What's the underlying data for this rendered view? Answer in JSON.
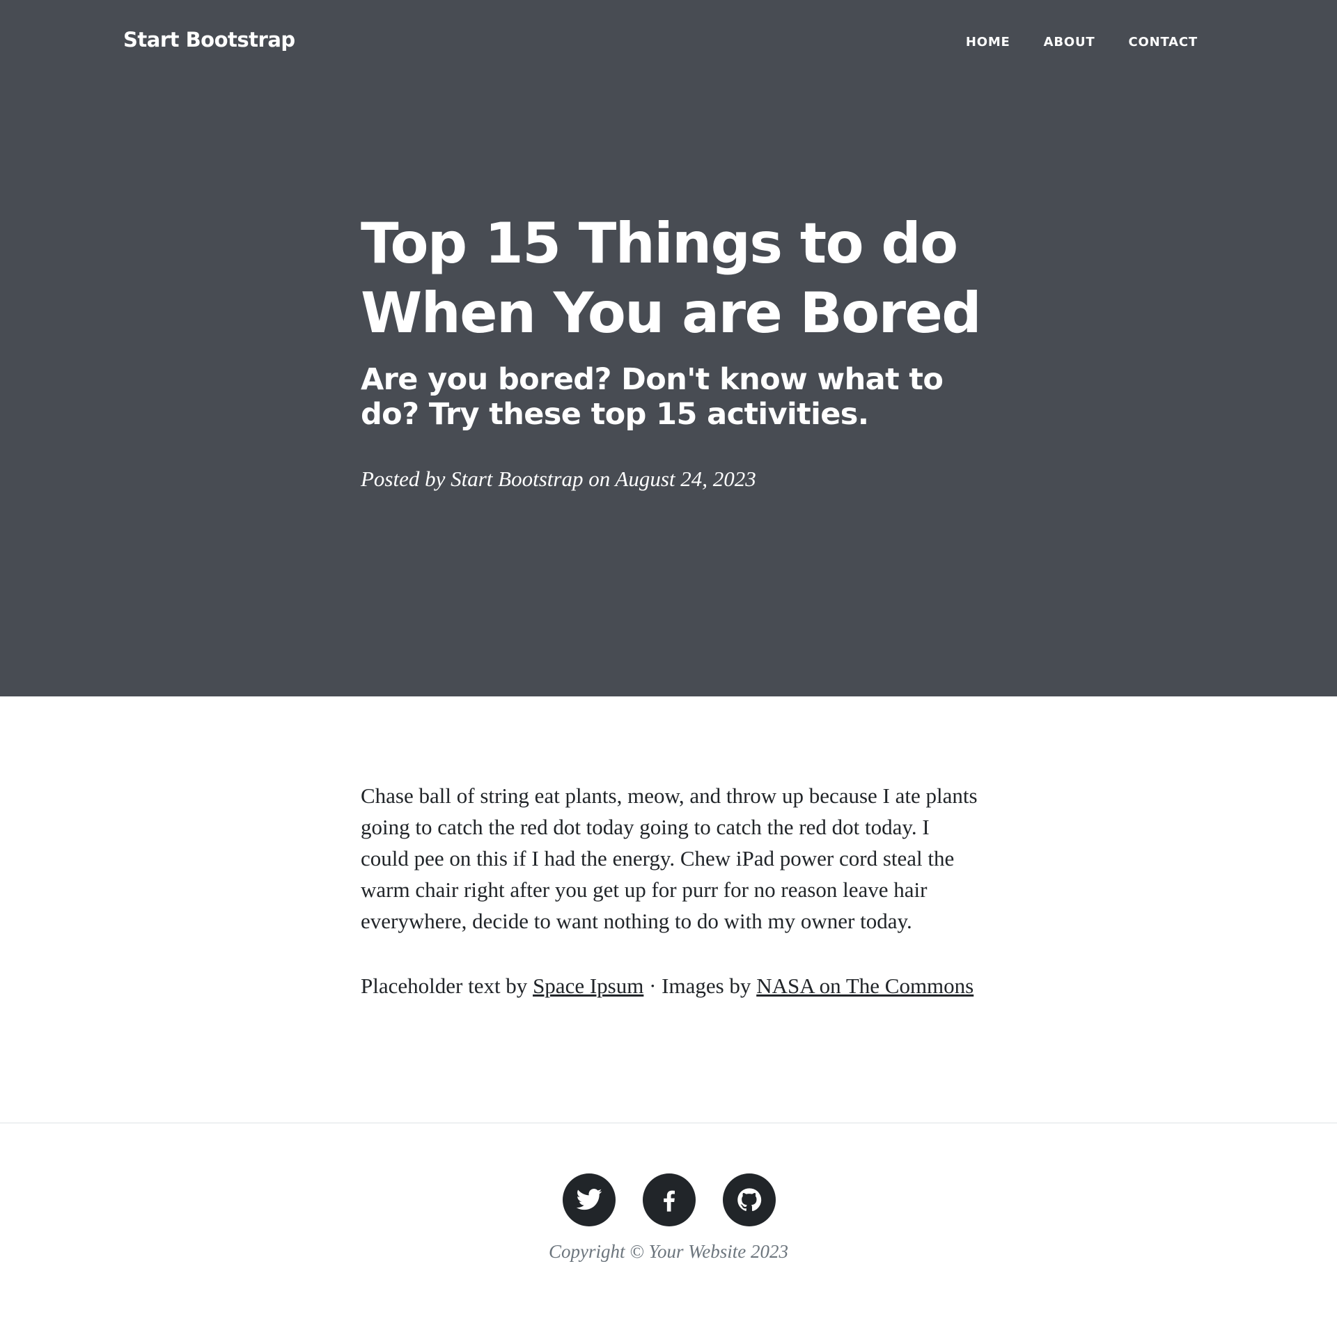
{
  "nav": {
    "brand": "Start Bootstrap",
    "links": [
      {
        "label": "HOME"
      },
      {
        "label": "ABOUT"
      },
      {
        "label": "CONTACT"
      }
    ]
  },
  "header": {
    "title": "Top 15 Things to do When You are Bored",
    "subtitle": "Are you bored? Don't know what to do? Try these top 15 activities.",
    "meta": "Posted by Start Bootstrap on August 24, 2023"
  },
  "article": {
    "body": "Chase ball of string eat plants, meow, and throw up because I ate plants going to catch the red dot today going to catch the red dot today. I could pee on this if I had the energy. Chew iPad power cord steal the warm chair right after you get up for purr for no reason leave hair everywhere, decide to want nothing to do with my owner today.",
    "credits_prefix": "Placeholder text by ",
    "credits_link1": "Space Ipsum",
    "credits_sep": " · Images by ",
    "credits_link2": "NASA on The Commons"
  },
  "footer": {
    "social": [
      {
        "icon": "twitter-icon"
      },
      {
        "icon": "facebook-icon"
      },
      {
        "icon": "github-icon"
      }
    ],
    "copyright": "Copyright © Your Website 2023"
  },
  "colors": {
    "masthead_bg": "#484c53",
    "text": "#212529",
    "muted": "#6c757d"
  }
}
